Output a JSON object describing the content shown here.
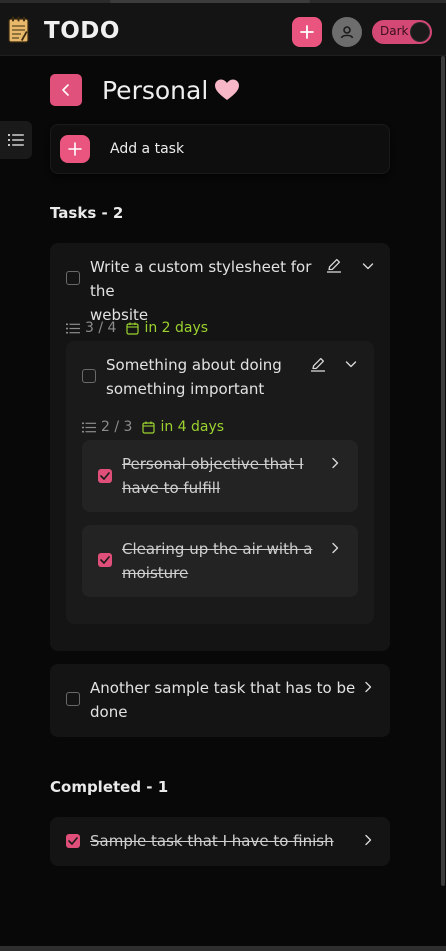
{
  "header": {
    "title": "TODO",
    "theme_label": "Dark"
  },
  "list": {
    "name": "Personal"
  },
  "add_task": {
    "label": "Add a task"
  },
  "tasks_section": {
    "heading": "Tasks - 2"
  },
  "tasks": [
    {
      "text_line1": "Write a custom stylesheet for the",
      "text_line2": "website",
      "count": "3 / 4",
      "due": "in 2 days",
      "subtasks": [
        {
          "text_line1": "Something about doing",
          "text_line2": "something important",
          "count": "2 / 3",
          "due": "in 4 days",
          "subtasks": [
            {
              "text_line1": "Personal objective that I",
              "text_line2": "have to fulfill",
              "completed": true
            },
            {
              "text_line1": "Clearing up the air with a",
              "text_line2": "moisture",
              "completed": true
            }
          ]
        }
      ]
    },
    {
      "text_line1": "Another sample task that has to be",
      "text_line2": "done"
    }
  ],
  "completed_section": {
    "heading": "Completed - 1"
  },
  "completed": [
    {
      "text": "Sample task that I have to finish",
      "completed": true
    }
  ],
  "colors": {
    "accent": "#e9557f",
    "due": "#9bd22f",
    "background": "#080808"
  }
}
